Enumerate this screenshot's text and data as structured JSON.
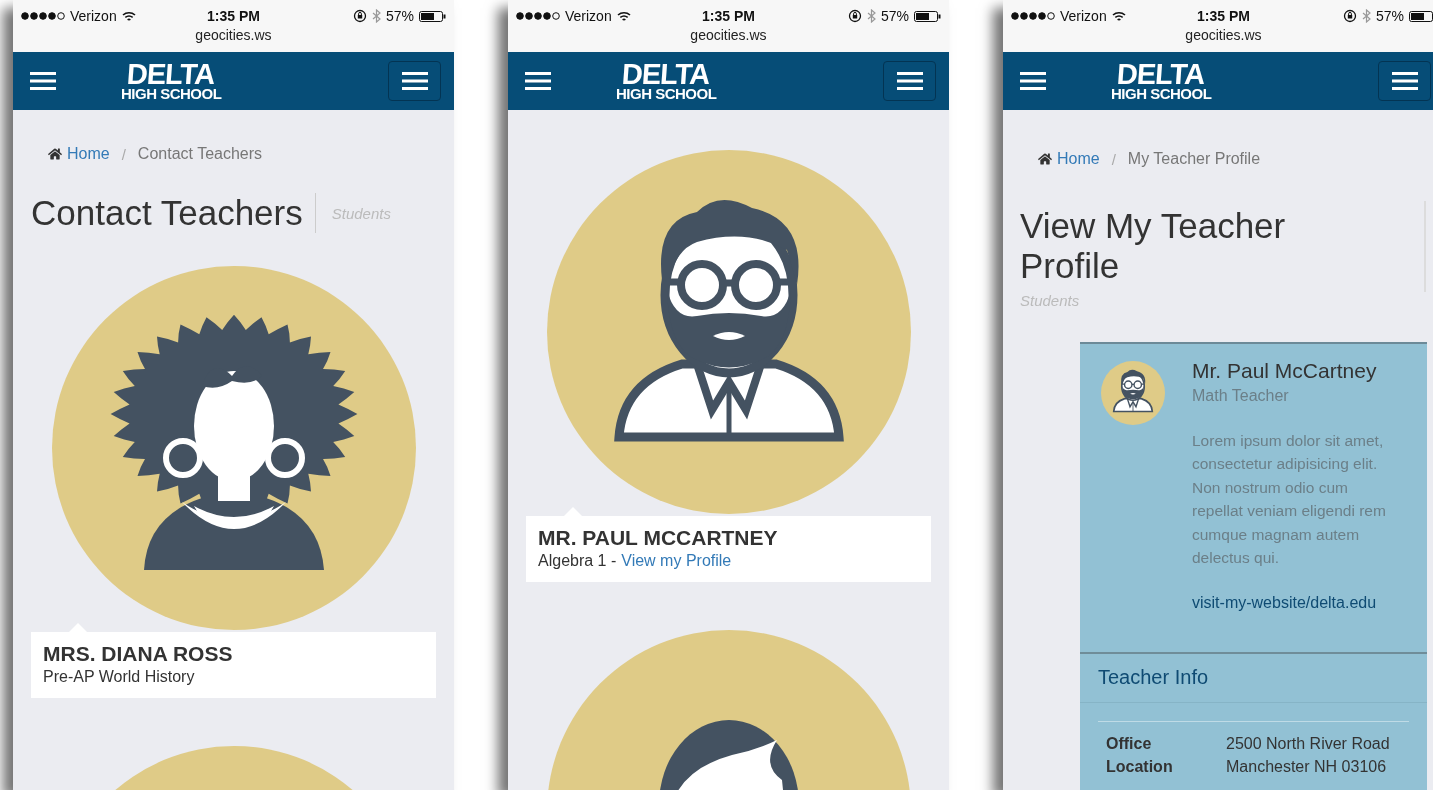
{
  "phones": [
    {
      "kind": "teacher_list",
      "status": {
        "carrier": "Verizon",
        "time": "1:35 PM",
        "battery": "57%"
      },
      "url": "geocities.ws",
      "logo": {
        "title": "DELTA",
        "subtitle": "HIGH SCHOOL"
      },
      "breadcrumb": {
        "home": "Home",
        "separator": "/",
        "current": "Contact Teachers"
      },
      "heading": "Contact Teachers",
      "subheading": "Students",
      "teachers": [
        {
          "kind": "curly_hair",
          "name": "MRS. DIANA ROSS",
          "subject": "Pre-AP World History"
        },
        {
          "kind": "plain"
        }
      ]
    },
    {
      "kind": "teacher_list",
      "status": {
        "carrier": "Verizon",
        "time": "1:35 PM",
        "battery": "57%"
      },
      "url": "geocities.ws",
      "logo": {
        "title": "DELTA",
        "subtitle": "HIGH SCHOOL"
      },
      "teachers": [
        {
          "kind": "glasses_beard",
          "name": "MR. PAUL MCCARTNEY",
          "subject": "Algebra 1 -",
          "link": "View my Profile"
        },
        {
          "kind": "short_hair"
        }
      ]
    },
    {
      "kind": "teacher_profile",
      "status": {
        "carrier": "Verizon",
        "time": "1:35 PM",
        "battery": "57%"
      },
      "url": "geocities.ws",
      "logo": {
        "title": "DELTA",
        "subtitle": "HIGH SCHOOL"
      },
      "breadcrumb": {
        "home": "Home",
        "separator": "/",
        "current": "My Teacher Profile"
      },
      "heading": "View My Teacher Profile",
      "subheading": "Students",
      "profile": {
        "kind": "glasses_beard",
        "name": "Mr. Paul McCartney",
        "role": "Math Teacher",
        "bio": "Lorem ipsum dolor sit amet, consectetur adipisicing elit. Non nostrum odio cum repellat veniam eligendi rem cumque magnam autem delectus qui.",
        "website": "visit-my-website/delta.edu",
        "info_title": "Teacher Info",
        "info": [
          {
            "label": "Office Location",
            "value": "2500 North River Road Manchester NH 03106"
          }
        ]
      }
    }
  ]
}
